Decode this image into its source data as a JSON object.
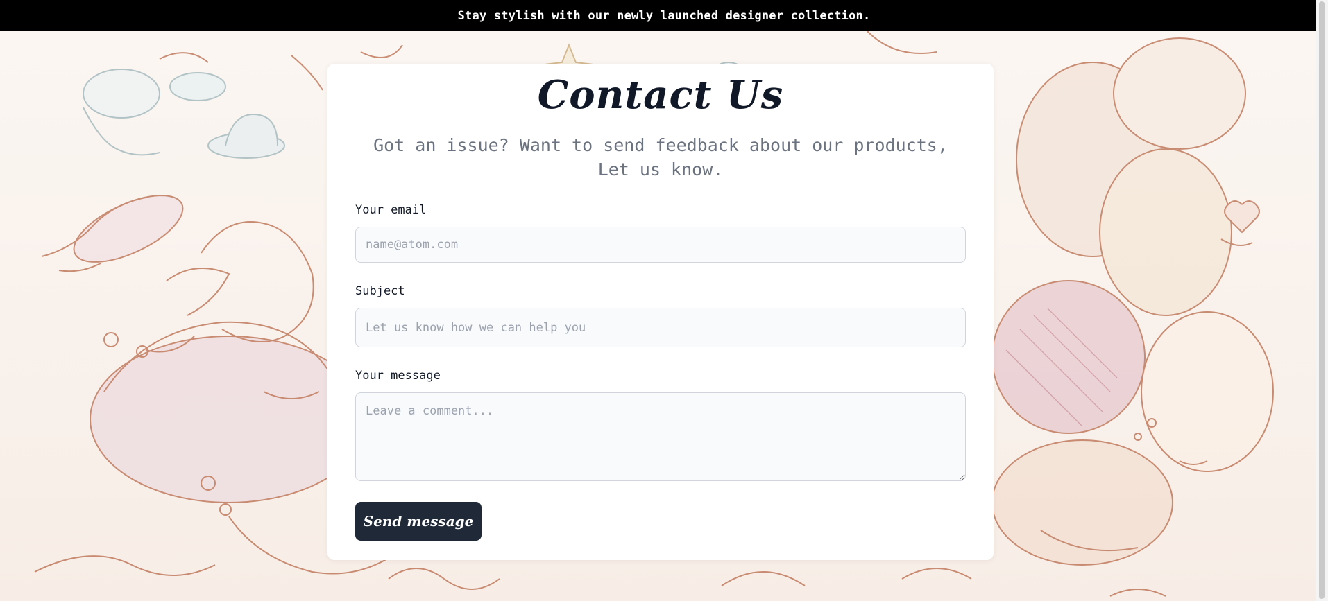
{
  "announcement": {
    "text": "Stay stylish with our newly launched designer collection."
  },
  "contact": {
    "title": "Contact Us",
    "subtitle": "Got an issue? Want to send feedback about our products, Let us know.",
    "email_label": "Your email",
    "email_placeholder": "name@atom.com",
    "email_value": "",
    "subject_label": "Subject",
    "subject_placeholder": "Let us know how we can help you",
    "subject_value": "",
    "message_label": "Your message",
    "message_placeholder": "Leave a comment...",
    "message_value": "",
    "send_label": "Send message"
  },
  "colors": {
    "announcement_bg": "#000000",
    "button_bg": "#1f2937",
    "title_text": "#111827",
    "subtitle_text": "#6b7280",
    "sketch_stroke": "#b86a4a"
  }
}
